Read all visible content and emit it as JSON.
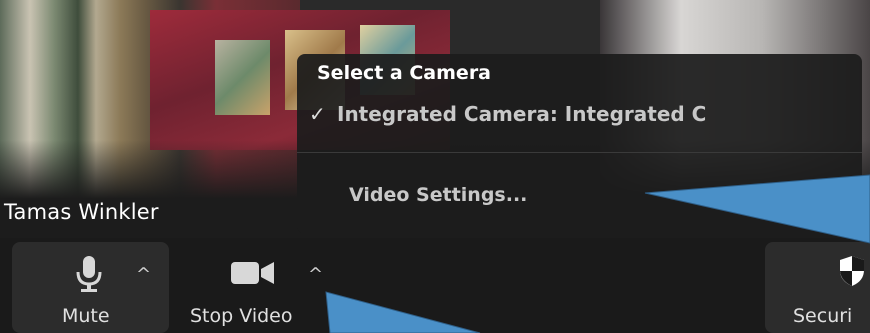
{
  "participant": {
    "name": "Tamas Winkler"
  },
  "camera_menu": {
    "heading": "Select a Camera",
    "selected_camera": "Integrated Camera: Integrated C",
    "check_mark": "✓",
    "settings_label": "Video Settings..."
  },
  "toolbar": {
    "mute_label": "Mute",
    "video_label": "Stop Video",
    "security_label": "Securi",
    "caret": "^"
  },
  "icons": {
    "mute": "microphone-icon",
    "video": "video-camera-icon",
    "security": "shield-icon",
    "check": "check-icon",
    "caret": "caret-up-icon"
  },
  "colors": {
    "annotation_arrow": "#4a90c8",
    "toolbar_bg": "#1a1a1a",
    "button_bg": "#2c2c2c"
  }
}
